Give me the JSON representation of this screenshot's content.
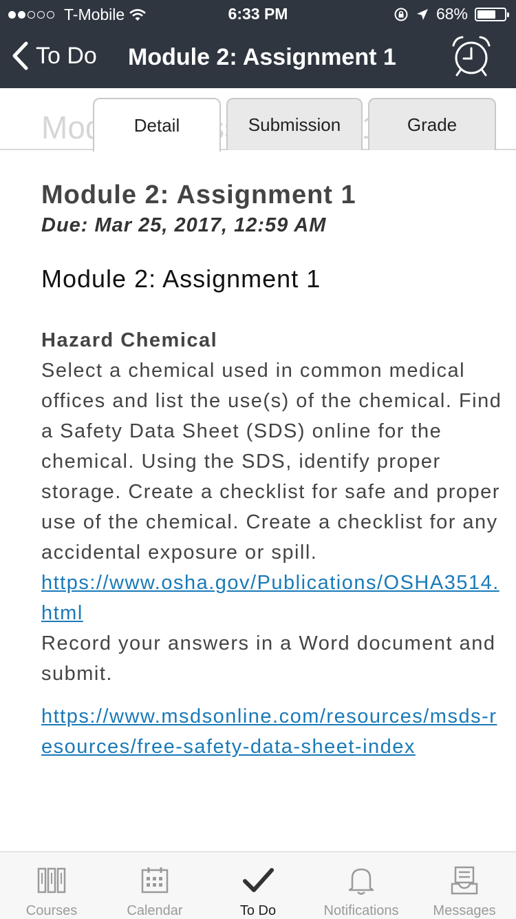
{
  "status_bar": {
    "carrier": "T-Mobile",
    "time": "6:33 PM",
    "battery": "68%",
    "battery_level": 0.68,
    "signal_bars_filled": 2,
    "signal_bars_total": 5
  },
  "header": {
    "back_label": "To Do",
    "title": "Module 2: Assignment 1",
    "alarm_icon": "alarm-clock-icon"
  },
  "tabs": {
    "ghost_text": "Module 2: Assignment 1",
    "items": [
      {
        "label": "Detail",
        "active": true
      },
      {
        "label": "Submission",
        "active": false
      },
      {
        "label": "Grade",
        "active": false
      }
    ]
  },
  "assignment": {
    "title": "Module 2: Assignment 1",
    "due": "Due: Mar 25, 2017, 12:59 AM",
    "heading": "Module 2: Assignment 1",
    "section_title": "Hazard Chemical",
    "body": "Select a chemical used in common medical offices and list the use(s) of the chemical. Find a Safety Data Sheet (SDS) online for the chemical. Using the SDS, identify proper storage. Create a checklist for safe and proper use of the chemical. Create a checklist for any accidental exposure or spill.",
    "link1": "https://www.osha.gov/Publications/OSHA3514.html",
    "instruction": "Record your answers in a Word document and submit.",
    "link2": "https://www.msdsonline.com/resources/msds-resources/free-safety-data-sheet-index"
  },
  "tabbar": {
    "items": [
      {
        "label": "Courses",
        "icon": "books-icon",
        "active": false
      },
      {
        "label": "Calendar",
        "icon": "calendar-icon",
        "active": false
      },
      {
        "label": "To Do",
        "icon": "checkmark-icon",
        "active": true
      },
      {
        "label": "Notifications",
        "icon": "bell-icon",
        "active": false
      },
      {
        "label": "Messages",
        "icon": "inbox-icon",
        "active": false
      }
    ]
  },
  "colors": {
    "header_bg": "#2f3640",
    "link": "#1a7ab8",
    "inactive_tab": "#e9e9e9"
  }
}
